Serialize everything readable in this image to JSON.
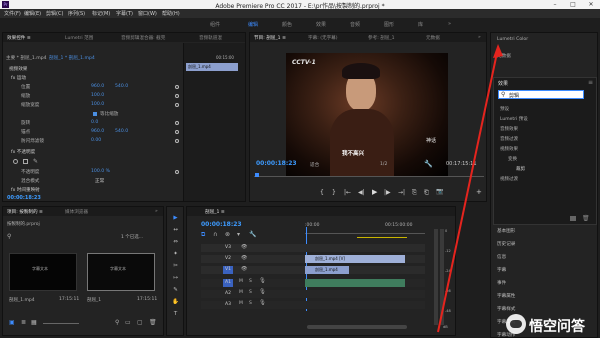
{
  "titlebar": {
    "app_icon": "Pr",
    "title": "Adobe Premiere Pro CC 2017 - E:\\pr作品\\按製制的.prproj *",
    "min": "–",
    "max": "□",
    "close": "✕"
  },
  "menu": [
    "文件(F)",
    "编辑(E)",
    "剪辑(C)",
    "序列(S)",
    "标记(M)",
    "字幕(T)",
    "窗口(W)",
    "帮助(H)"
  ],
  "workspaces": [
    "组件",
    "编辑",
    "颜色",
    "效果",
    "音频",
    "图形",
    "库"
  ],
  "workspaces_more": "»",
  "effect_controls": {
    "tabs": [
      "效果控件 ≡",
      "Lumetri 范围",
      "音频剪辑混合器: 截完",
      "音频轨道混"
    ],
    "source_line": "主要 * 剖屈_1.mp4",
    "seq_line": "剖屈_1 * 剖屈_1.mp4",
    "video_effects": "视频效果",
    "motion": "fx 运动",
    "rows": [
      {
        "label": "位置",
        "v1": "960.0",
        "v2": "540.0"
      },
      {
        "label": "缩放",
        "v1": "100.0",
        "v2": ""
      },
      {
        "label": "缩放宽度",
        "v1": "100.0",
        "v2": ""
      },
      {
        "label": "",
        "v1": "等比缩放",
        "v2": ""
      },
      {
        "label": "旋转",
        "v1": "0.0",
        "v2": ""
      },
      {
        "label": "锚点",
        "v1": "960.0",
        "v2": "540.0"
      },
      {
        "label": "防闪烁滤镜",
        "v1": "0.00",
        "v2": ""
      }
    ],
    "opacity": "fx 不透明度",
    "opacity_rows": [
      {
        "label": "不透明度",
        "v1": "100.0 %"
      },
      {
        "label": "混合模式",
        "v1": "正常"
      }
    ],
    "time_remap": "fx 时间重映射",
    "timecode": "00:00:18:23",
    "mini_time": "00:15:00",
    "mini_clip": "剖屈_1.mp4"
  },
  "program": {
    "tabs": [
      "节目: 剖屈_1 ≡",
      "字幕: (无字幕)",
      "参考: 剖屈_1",
      "元数据"
    ],
    "tabs_more": "»",
    "logo": "CCTV-1",
    "subtitle": "我不高兴",
    "side_text": "神话",
    "timecode": "00:00:18:23",
    "fit": "适合",
    "res": "1/2",
    "duration": "00:17:15:11",
    "controls": [
      "{",
      "}",
      "|←",
      "◀|",
      "▶",
      "|▶",
      "→|",
      "⎘",
      "⎗",
      "📷",
      "+"
    ]
  },
  "right_panel": {
    "items_top": [
      "Lumetri Color",
      "元数据"
    ],
    "effects_title": "效果",
    "search_value": "剪辑",
    "tree": [
      {
        "label": "预设",
        "indent": 0
      },
      {
        "label": "Lumetri 预设",
        "indent": 0
      },
      {
        "label": "音频效果",
        "indent": 0
      },
      {
        "label": "音频过渡",
        "indent": 0
      },
      {
        "label": "视频效果",
        "indent": 0
      },
      {
        "label": "变换",
        "indent": 1
      },
      {
        "label": "裁剪",
        "indent": 2
      },
      {
        "label": "视频过渡",
        "indent": 0
      }
    ],
    "items_bottom": [
      "基本图形",
      "历史记录",
      "信息",
      "字幕",
      "事件",
      "字幕属性",
      "字幕样式",
      "字幕工具",
      "字幕动作"
    ]
  },
  "project": {
    "tabs": [
      "项目: 按製制的 ≡",
      "媒体浏览器"
    ],
    "tabs_more": "»",
    "file": "按製制的.prproj",
    "count": "1 个已选...",
    "items": [
      {
        "name": "剖屈_1.mp4",
        "dur": "17:15:11",
        "thumb": "字幕文本"
      },
      {
        "name": "剖屈_1",
        "dur": "17:15:11",
        "thumb": "字幕文本"
      }
    ]
  },
  "timeline": {
    "tab": "剖屈_1 ≡",
    "timecode": "00:00:18:23",
    "ruler": [
      ":00:00",
      "00:15:00:00"
    ],
    "tracks_v": [
      "V3",
      "V2",
      "V1"
    ],
    "tracks_a": [
      "A1",
      "A2",
      "A3"
    ],
    "track_btns": [
      "M",
      "S"
    ],
    "clip_v2": "剖屈_1.mp4 [V]",
    "clip_v1": "剖屈_1.mp4",
    "tools": [
      "▶",
      "↔",
      "⇔",
      "✦",
      "✂",
      "↦",
      "✎",
      "✋",
      "T"
    ],
    "meter_labels": [
      "0",
      "-12",
      "-24",
      "-36",
      "-48",
      "dB"
    ]
  },
  "watermark": "悟空问答",
  "annotation_color": "#e5241e"
}
